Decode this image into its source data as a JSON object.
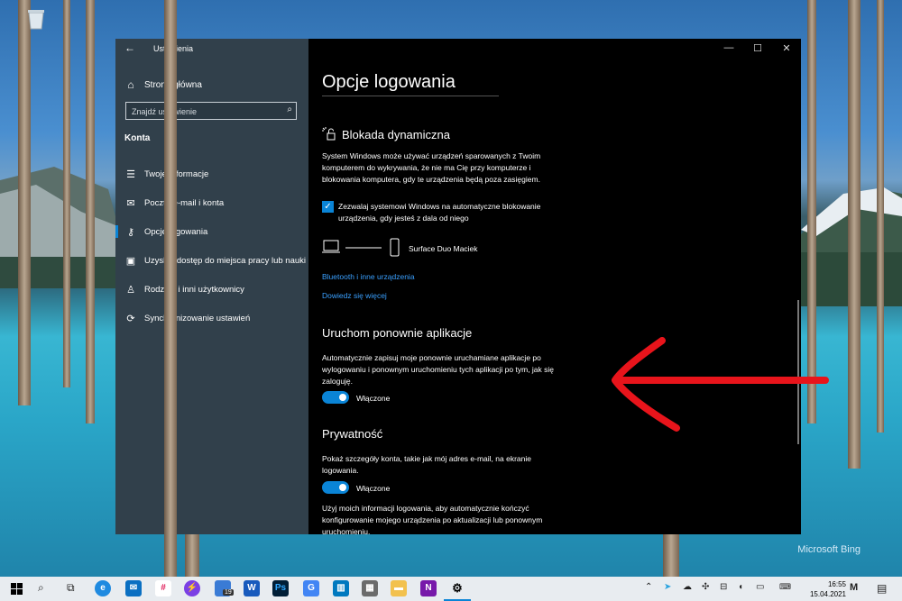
{
  "desktop": {
    "watermark": "Microsoft Bing"
  },
  "window": {
    "title": "Ustawienia",
    "controls": {
      "minimize": "—",
      "maximize": "☐",
      "close": "✕"
    }
  },
  "sidebar": {
    "home_label": "Strona główna",
    "search_placeholder": "Znajdź ustawienie",
    "section_label": "Konta",
    "items": [
      {
        "label": "Twoje informacje",
        "icon": "person-card-icon"
      },
      {
        "label": "Poczta e-mail i konta",
        "icon": "mail-icon"
      },
      {
        "label": "Opcje logowania",
        "icon": "key-icon",
        "active": true
      },
      {
        "label": "Uzyskaj dostęp do miejsca pracy lub nauki",
        "icon": "briefcase-icon"
      },
      {
        "label": "Rodzina i inni użytkownicy",
        "icon": "person-icon"
      },
      {
        "label": "Synchronizowanie ustawień",
        "icon": "sync-icon"
      }
    ]
  },
  "content": {
    "page_title": "Opcje logowania",
    "dynamic_lock": {
      "heading": "Blokada dynamiczna",
      "description": "System Windows może używać urządzeń sparowanych z Twoim komputerem do wykrywania, że nie ma Cię przy komputerze i blokowania komputera, gdy te urządzenia będą poza zasięgiem.",
      "checkbox_label": "Zezwalaj systemowi Windows na automatyczne blokowanie urządzenia, gdy jesteś z dala od niego",
      "checkbox_checked": true,
      "device_name": "Surface Duo Maciek",
      "link_bluetooth": "Bluetooth i inne urządzenia",
      "link_more": "Dowiedz się więcej"
    },
    "restart_apps": {
      "heading": "Uruchom ponownie aplikacje",
      "description": "Automatycznie zapisuj moje ponownie uruchamiane aplikacje po wylogowaniu i ponownym uruchomieniu tych aplikacji po tym, jak się zaloguję.",
      "toggle_label": "Włączone",
      "toggle_on": true
    },
    "privacy": {
      "heading": "Prywatność",
      "description1": "Pokaż szczegóły konta, takie jak mój adres e-mail, na ekranie logowania.",
      "toggle_label": "Włączone",
      "toggle_on": true,
      "description2": "Użyj moich informacji logowania, aby automatycznie kończyć konfigurowanie mojego urządzenia po aktualizacji lub ponownym uruchomieniu."
    }
  },
  "taskbar": {
    "badge_count": "19",
    "time": "16:55",
    "date": "15.04.2021",
    "colors": {
      "accent": "#0a84d6",
      "annotation": "#e8141b"
    }
  }
}
